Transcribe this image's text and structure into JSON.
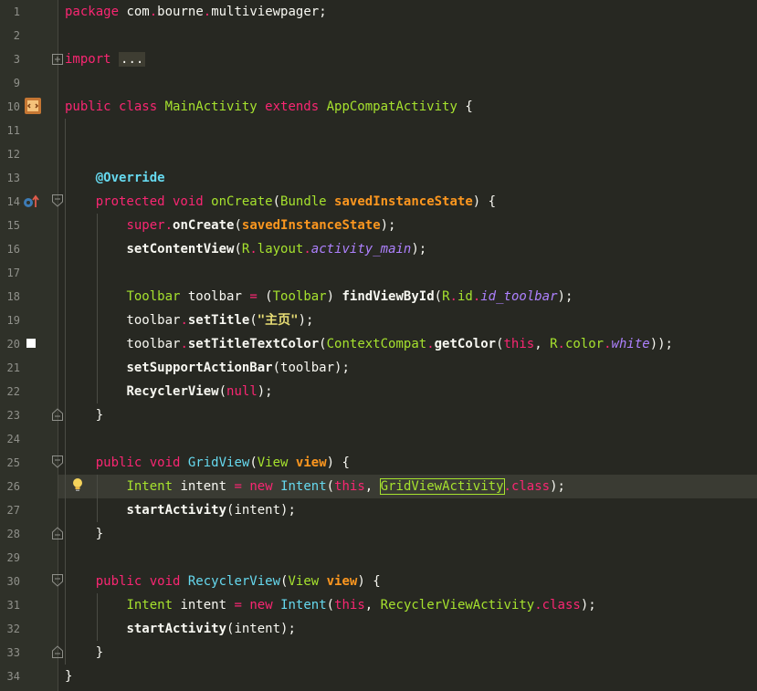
{
  "editor": {
    "lines": [
      {
        "num": "1",
        "tokens": [
          [
            "kw",
            "package"
          ],
          [
            "plain",
            " com"
          ],
          [
            "dot",
            "."
          ],
          [
            "plain",
            "bourne"
          ],
          [
            "dot",
            "."
          ],
          [
            "plain",
            "multiviewpager;"
          ]
        ]
      },
      {
        "num": "2",
        "tokens": []
      },
      {
        "num": "3",
        "tokens": [
          [
            "kw",
            "import"
          ],
          [
            "plain",
            " "
          ],
          [
            "folded",
            "..."
          ]
        ]
      },
      {
        "num": "9",
        "tokens": []
      },
      {
        "num": "10",
        "tokens": [
          [
            "kw",
            "public class "
          ],
          [
            "def",
            "MainActivity"
          ],
          [
            "kw",
            " extends "
          ],
          [
            "type",
            "AppCompatActivity"
          ],
          [
            "plain",
            " {"
          ]
        ]
      },
      {
        "num": "11",
        "tokens": []
      },
      {
        "num": "12",
        "tokens": []
      },
      {
        "num": "13",
        "tokens": [
          [
            "plain",
            "    "
          ],
          [
            "annot",
            "@Override"
          ]
        ]
      },
      {
        "num": "14",
        "tokens": [
          [
            "plain",
            "    "
          ],
          [
            "kw",
            "protected void "
          ],
          [
            "def",
            "onCreate"
          ],
          [
            "plain",
            "("
          ],
          [
            "type",
            "Bundle "
          ],
          [
            "param",
            "savedInstanceState"
          ],
          [
            "plain",
            ") {"
          ]
        ]
      },
      {
        "num": "15",
        "tokens": [
          [
            "plain",
            "        "
          ],
          [
            "kw",
            "super"
          ],
          [
            "dot",
            "."
          ],
          [
            "call",
            "onCreate"
          ],
          [
            "plain",
            "("
          ],
          [
            "param",
            "savedInstanceState"
          ],
          [
            "plain",
            ");"
          ]
        ]
      },
      {
        "num": "16",
        "tokens": [
          [
            "plain",
            "        "
          ],
          [
            "call",
            "setContentView"
          ],
          [
            "plain",
            "("
          ],
          [
            "type",
            "R"
          ],
          [
            "dot",
            "."
          ],
          [
            "type",
            "layout"
          ],
          [
            "dot",
            "."
          ],
          [
            "field",
            "activity_main"
          ],
          [
            "plain",
            ");"
          ]
        ]
      },
      {
        "num": "17",
        "tokens": []
      },
      {
        "num": "18",
        "tokens": [
          [
            "plain",
            "        "
          ],
          [
            "type",
            "Toolbar "
          ],
          [
            "plain",
            "toolbar "
          ],
          [
            "kw",
            "="
          ],
          [
            "plain",
            " ("
          ],
          [
            "type",
            "Toolbar"
          ],
          [
            "plain",
            ") "
          ],
          [
            "call",
            "findViewById"
          ],
          [
            "plain",
            "("
          ],
          [
            "type",
            "R"
          ],
          [
            "dot",
            "."
          ],
          [
            "type",
            "id"
          ],
          [
            "dot",
            "."
          ],
          [
            "field",
            "id_toolbar"
          ],
          [
            "plain",
            ");"
          ]
        ]
      },
      {
        "num": "19",
        "tokens": [
          [
            "plain",
            "        toolbar"
          ],
          [
            "dot",
            "."
          ],
          [
            "call",
            "setTitle"
          ],
          [
            "plain",
            "("
          ],
          [
            "str",
            "\"主页\""
          ],
          [
            "plain",
            ");"
          ]
        ]
      },
      {
        "num": "20",
        "tokens": [
          [
            "plain",
            "        toolbar"
          ],
          [
            "dot",
            "."
          ],
          [
            "call",
            "setTitleTextColor"
          ],
          [
            "plain",
            "("
          ],
          [
            "type",
            "ContextCompat"
          ],
          [
            "dot",
            "."
          ],
          [
            "call",
            "getColor"
          ],
          [
            "plain",
            "("
          ],
          [
            "kw",
            "this"
          ],
          [
            "plain",
            ", "
          ],
          [
            "type",
            "R"
          ],
          [
            "dot",
            "."
          ],
          [
            "type",
            "color"
          ],
          [
            "dot",
            "."
          ],
          [
            "field",
            "white"
          ],
          [
            "plain",
            "));"
          ]
        ]
      },
      {
        "num": "21",
        "tokens": [
          [
            "plain",
            "        "
          ],
          [
            "call",
            "setSupportActionBar"
          ],
          [
            "plain",
            "(toolbar);"
          ]
        ]
      },
      {
        "num": "22",
        "tokens": [
          [
            "plain",
            "        "
          ],
          [
            "call",
            "RecyclerView"
          ],
          [
            "plain",
            "("
          ],
          [
            "kw",
            "null"
          ],
          [
            "plain",
            ");"
          ]
        ]
      },
      {
        "num": "23",
        "tokens": [
          [
            "plain",
            "    }"
          ]
        ]
      },
      {
        "num": "24",
        "tokens": []
      },
      {
        "num": "25",
        "tokens": [
          [
            "plain",
            "    "
          ],
          [
            "kw",
            "public void "
          ],
          [
            "cls",
            "GridView"
          ],
          [
            "plain",
            "("
          ],
          [
            "type",
            "View "
          ],
          [
            "param",
            "view"
          ],
          [
            "plain",
            ") {"
          ]
        ]
      },
      {
        "num": "26",
        "tokens": [
          [
            "plain",
            "        "
          ],
          [
            "type",
            "Intent "
          ],
          [
            "plain",
            "intent "
          ],
          [
            "kw",
            "="
          ],
          [
            "kw",
            " new "
          ],
          [
            "cls",
            "Intent"
          ],
          [
            "plain",
            "("
          ],
          [
            "kw",
            "this"
          ],
          [
            "plain",
            ", "
          ],
          [
            "highlight",
            "GridViewActivity"
          ],
          [
            "dot",
            "."
          ],
          [
            "kw",
            "class"
          ],
          [
            "plain",
            ");"
          ]
        ]
      },
      {
        "num": "27",
        "tokens": [
          [
            "plain",
            "        "
          ],
          [
            "call",
            "startActivity"
          ],
          [
            "plain",
            "(intent);"
          ]
        ]
      },
      {
        "num": "28",
        "tokens": [
          [
            "plain",
            "    }"
          ]
        ]
      },
      {
        "num": "29",
        "tokens": []
      },
      {
        "num": "30",
        "tokens": [
          [
            "plain",
            "    "
          ],
          [
            "kw",
            "public void "
          ],
          [
            "cls",
            "RecyclerView"
          ],
          [
            "plain",
            "("
          ],
          [
            "type",
            "View "
          ],
          [
            "param",
            "view"
          ],
          [
            "plain",
            ") {"
          ]
        ]
      },
      {
        "num": "31",
        "tokens": [
          [
            "plain",
            "        "
          ],
          [
            "type",
            "Intent "
          ],
          [
            "plain",
            "intent "
          ],
          [
            "kw",
            "="
          ],
          [
            "kw",
            " new "
          ],
          [
            "cls",
            "Intent"
          ],
          [
            "plain",
            "("
          ],
          [
            "kw",
            "this"
          ],
          [
            "plain",
            ", "
          ],
          [
            "type",
            "RecyclerViewActivity"
          ],
          [
            "dot",
            "."
          ],
          [
            "kw",
            "class"
          ],
          [
            "plain",
            ");"
          ]
        ]
      },
      {
        "num": "32",
        "tokens": [
          [
            "plain",
            "        "
          ],
          [
            "call",
            "startActivity"
          ],
          [
            "plain",
            "(intent);"
          ]
        ]
      },
      {
        "num": "33",
        "tokens": [
          [
            "plain",
            "    }"
          ]
        ]
      },
      {
        "num": "34",
        "tokens": [
          [
            "plain",
            "}"
          ]
        ]
      }
    ],
    "current_line": "26",
    "gutter_icons": {
      "line10": "class-implementation-icon",
      "line14": "override-method-icon",
      "line20": "color-preview-icon",
      "line26": "intention-bulb-icon"
    },
    "colors": {
      "background": "#272822",
      "keyword": "#f92672",
      "type": "#a6e22e",
      "method": "#66d9ef",
      "param": "#fd971f",
      "field": "#ae81ff",
      "string": "#e6db74"
    }
  }
}
